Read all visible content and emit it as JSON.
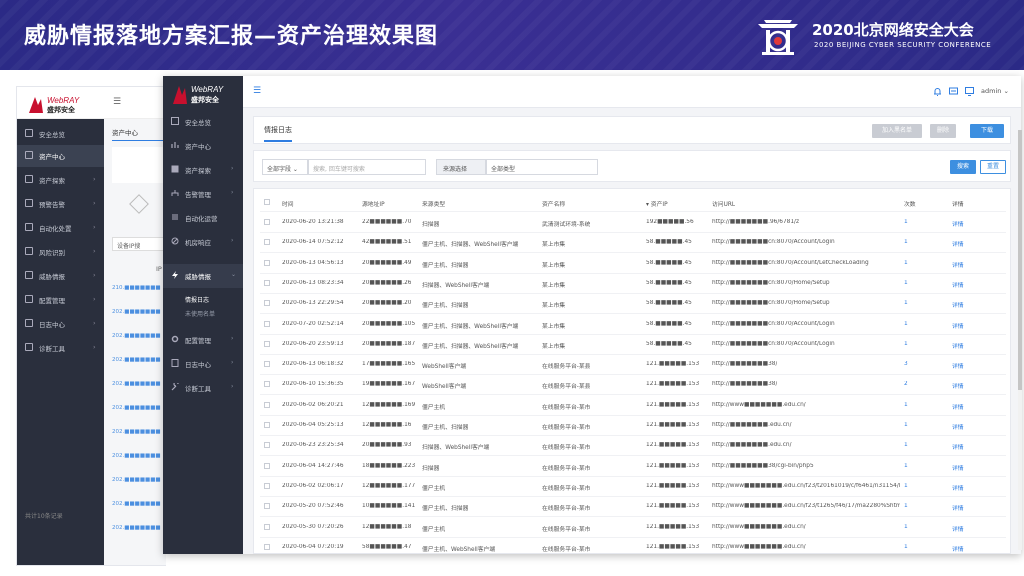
{
  "banner": {
    "title": "威胁情报落地方案汇报—资产治理效果图",
    "conf_name": "2020北京网络安全大会",
    "conf_sub": "2020 BEIJING CYBER SECURITY CONFERENCE",
    "brand_color": "#2b2a86"
  },
  "back_window": {
    "logo_en": "WebRAY",
    "logo_cn": "盛邦安全",
    "menu": [
      {
        "label": "安全总览",
        "active": false
      },
      {
        "label": "资产中心",
        "active": true
      },
      {
        "label": "资产探索",
        "active": false
      },
      {
        "label": "预警告警",
        "active": false
      },
      {
        "label": "自动化处置",
        "active": false
      },
      {
        "label": "风险识别",
        "active": false
      },
      {
        "label": "威胁情报",
        "active": false
      },
      {
        "label": "配置管理",
        "active": false
      },
      {
        "label": "日志中心",
        "active": false
      },
      {
        "label": "诊断工具",
        "active": false
      }
    ],
    "tab": "资产中心",
    "filter": "设备IP搜",
    "col_ip": "IP",
    "rows": [
      "210.■■■■■■■",
      "202.■■■■■■■",
      "202.■■■■■■■",
      "202.■■■■■■■",
      "202.■■■■■■■",
      "202.■■■■■■■",
      "202.■■■■■■■",
      "202.■■■■■■■",
      "202.■■■■■■■",
      "202.■■■■■■■",
      "202.■■■■■■■"
    ],
    "footer": "共计10条记录"
  },
  "sidebar": {
    "logo_en": "WebRAY",
    "logo_cn": "盛邦安全",
    "items": [
      {
        "label": "安全总览",
        "arrow": ""
      },
      {
        "label": "资产中心",
        "arrow": ""
      },
      {
        "label": "资产探索",
        "arrow": "›"
      },
      {
        "label": "告警管理",
        "arrow": "›"
      },
      {
        "label": "自动化运营",
        "arrow": ""
      },
      {
        "label": "机房响应",
        "arrow": "›"
      },
      {
        "label": "威胁情报",
        "arrow": "⌄"
      },
      {
        "label": "配置管理",
        "arrow": "›"
      },
      {
        "label": "日志中心",
        "arrow": "›"
      },
      {
        "label": "诊断工具",
        "arrow": "›"
      }
    ],
    "sub_items": [
      {
        "label": "情报日志",
        "active": true
      },
      {
        "label": "未使用名单",
        "active": false
      }
    ]
  },
  "topbar": {
    "menu_icon": "menu-icon",
    "user": "admin"
  },
  "header": {
    "tab": "情报日志",
    "buttons": {
      "blacklist": "加入黑名单",
      "delete": "删除",
      "download": "下载"
    }
  },
  "filters": {
    "field_select": "全部字段",
    "search_placeholder": "搜索, 回车键可搜索",
    "source_label": "来源选择",
    "type_select": "全部类型",
    "search_btn": "搜索",
    "reset_btn": "重置"
  },
  "table": {
    "headers": [
      "时间",
      "源地址IP",
      "来源类型",
      "资产名称",
      "资产IP",
      "访问URL",
      "次数",
      "详情"
    ],
    "rows": [
      {
        "time": "2020-06-20 13:21:38",
        "src": "22■■■■■■.70",
        "type": "扫描器",
        "asset": "武清测试环境-系统",
        "aip": "192■■■■■.56",
        "url": "http://■■■■■■■.96/6781/z",
        "count": "1",
        "detail": "详情"
      },
      {
        "time": "2020-06-14 07:52:12",
        "src": "42■■■■■■.51",
        "type": "僵尸主机、扫描器、WebShell客户端",
        "asset": "某上市集",
        "aip": "58.■■■■■.45",
        "url": "http://■■■■■■■cn:8070/Account/Login",
        "count": "1",
        "detail": "详情"
      },
      {
        "time": "2020-06-13 04:56:13",
        "src": "20■■■■■■.49",
        "type": "僵尸主机、扫描器",
        "asset": "某上市集",
        "aip": "58.■■■■■.45",
        "url": "http://■■■■■■■cn:8070/Account/LetCheckLoading",
        "count": "1",
        "detail": "详情"
      },
      {
        "time": "2020-06-13 08:23:34",
        "src": "20■■■■■■.26",
        "type": "扫描器、WebShell客户端",
        "asset": "某上市集",
        "aip": "58.■■■■■.45",
        "url": "http://■■■■■■■cn:8070/Home/Setup",
        "count": "1",
        "detail": "详情"
      },
      {
        "time": "2020-06-13 22:29:54",
        "src": "20■■■■■■.20",
        "type": "僵尸主机、扫描器",
        "asset": "某上市集",
        "aip": "58.■■■■■.45",
        "url": "http://■■■■■■■cn:8070/Home/Setup",
        "count": "1",
        "detail": "详情"
      },
      {
        "time": "2020-07-20 02:52:14",
        "src": "20■■■■■■.105",
        "type": "僵尸主机、扫描器、WebShell客户端",
        "asset": "某上市集",
        "aip": "58.■■■■■.45",
        "url": "http://■■■■■■■cn:8070/Account/Login",
        "count": "1",
        "detail": "详情"
      },
      {
        "time": "2020-06-20 23:59:13",
        "src": "20■■■■■■.187",
        "type": "僵尸主机、扫描器、WebShell客户端",
        "asset": "某上市集",
        "aip": "58.■■■■■.45",
        "url": "http://■■■■■■■cn:8070/Account/Login",
        "count": "1",
        "detail": "详情"
      },
      {
        "time": "2020-06-13 06:18:32",
        "src": "17■■■■■■.165",
        "type": "WebShell客户端",
        "asset": "在线服务平台-某县",
        "aip": "121.■■■■■.153",
        "url": "http://■■■■■■■38/",
        "count": "3",
        "detail": "详情"
      },
      {
        "time": "2020-06-10 15:36:35",
        "src": "19■■■■■■.167",
        "type": "WebShell客户端",
        "asset": "在线服务平台-某县",
        "aip": "121.■■■■■.153",
        "url": "http://■■■■■■■38/",
        "count": "2",
        "detail": "详情"
      },
      {
        "time": "2020-06-02 06:20:21",
        "src": "12■■■■■■.169",
        "type": "僵尸主机",
        "asset": "在线服务平台-某市",
        "aip": "121.■■■■■.153",
        "url": "http://www■■■■■■■.edu.cn/",
        "count": "1",
        "detail": "详情"
      },
      {
        "time": "2020-06-04 05:25:13",
        "src": "12■■■■■■.16",
        "type": "僵尸主机、扫描器",
        "asset": "在线服务平台-某市",
        "aip": "121.■■■■■.153",
        "url": "http://■■■■■■■.edu.cn/",
        "count": "1",
        "detail": "详情"
      },
      {
        "time": "2020-06-23 23:25:34",
        "src": "20■■■■■■.93",
        "type": "扫描器、WebShell客户端",
        "asset": "在线服务平台-某市",
        "aip": "121.■■■■■.153",
        "url": "http://■■■■■■■.edu.cn/",
        "count": "1",
        "detail": "详情"
      },
      {
        "time": "2020-06-04 14:27:46",
        "src": "18■■■■■■.223",
        "type": "扫描器",
        "asset": "在线服务平台-某市",
        "aip": "121.■■■■■.153",
        "url": "http://■■■■■■■38/cgi-bin/php5",
        "count": "1",
        "detail": "详情"
      },
      {
        "time": "2020-06-02 02:06:17",
        "src": "12■■■■■■.177",
        "type": "僵尸主机",
        "asset": "在线服务平台-某市",
        "aip": "121.■■■■■.153",
        "url": "http://www■■■■■■■.edu.cn/f23/t20161019/c/f6461/n31154/list.htm",
        "count": "1",
        "detail": "详情"
      },
      {
        "time": "2020-05-20 07:52:46",
        "src": "10■■■■■■.141",
        "type": "僵尸主机、扫描器",
        "asset": "在线服务平台-某市",
        "aip": "121.■■■■■.153",
        "url": "http://www■■■■■■■.edu.cn/f23/t1265/f46/17/ma2280%Shtm",
        "count": "1",
        "detail": "详情"
      },
      {
        "time": "2020-05-30 07:20:26",
        "src": "12■■■■■■.18",
        "type": "僵尸主机",
        "asset": "在线服务平台-某市",
        "aip": "121.■■■■■.153",
        "url": "http://www■■■■■■■.edu.cn/",
        "count": "1",
        "detail": "详情"
      },
      {
        "time": "2020-06-04 07:20:19",
        "src": "58■■■■■■.47",
        "type": "僵尸主机、WebShell客户端",
        "asset": "在线服务平台-某市",
        "aip": "121.■■■■■.153",
        "url": "http://www■■■■■■■.edu.cn/",
        "count": "1",
        "detail": "详情"
      }
    ]
  },
  "colors": {
    "sidebar_bg": "#2a2f3d",
    "accent": "#2f7de1",
    "page_bg": "#f3f4f7"
  }
}
